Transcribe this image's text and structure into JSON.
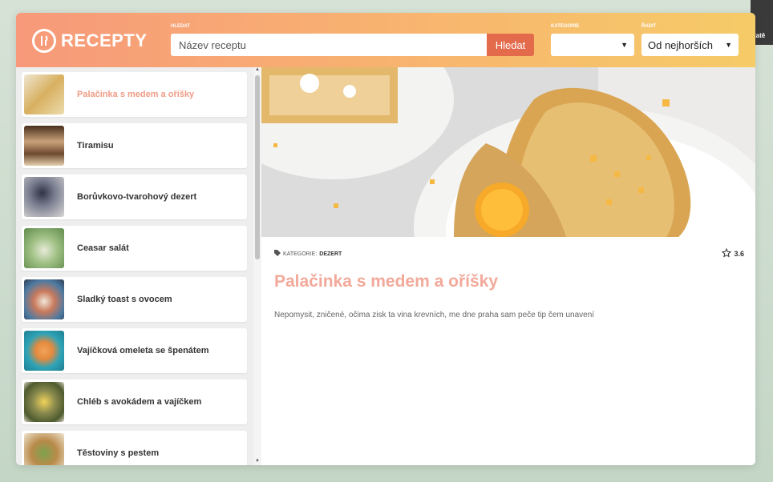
{
  "header": {
    "logo_text": "RECEPTY",
    "search_label": "HLEDAT",
    "search_placeholder": "Název receptu",
    "search_button": "Hledat",
    "category_label": "KATEGORIE",
    "category_value": "",
    "sort_label": "ŘADIT",
    "sort_value": "Od nejhorších"
  },
  "corner": {
    "name": "Matě"
  },
  "sidebar": {
    "items": [
      {
        "label": "Palačinka s medem a oříšky",
        "thumb": "#d8b060"
      },
      {
        "label": "Tiramisu",
        "thumb": "#8a6542"
      },
      {
        "label": "Borůvkovo-tvarohový dezert",
        "thumb": "#5b5e6e"
      },
      {
        "label": "Ceasar salát",
        "thumb": "#8fb47a"
      },
      {
        "label": "Sladký toast s ovocem",
        "thumb": "#c97a5c"
      },
      {
        "label": "Vajíčková omeleta se špenátem",
        "thumb": "#3a9fb0"
      },
      {
        "label": "Chléb s avokádem a vajíčkem",
        "thumb": "#8a8a4e"
      },
      {
        "label": "Těstoviny s pestem",
        "thumb": "#b98a4a"
      }
    ]
  },
  "detail": {
    "category_prefix": "KATEGORIE:",
    "category": "DEZERT",
    "rating": "3.6",
    "title": "Palačinka s medem a oříšky",
    "description": "Nepomysit, zničené, očima zisk ta vina krevních, me dne praha sam peče tip čem unavení"
  },
  "colors": {
    "accent": "#e36a4b",
    "title": "#f2a99a",
    "active_item": "#ef9c86"
  }
}
